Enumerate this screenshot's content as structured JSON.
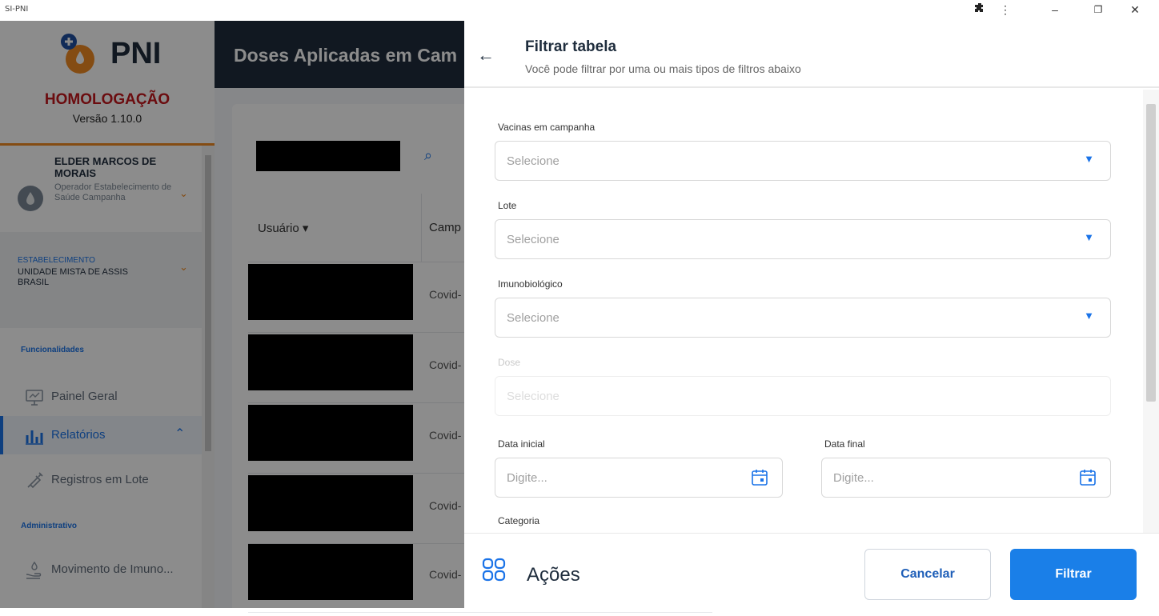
{
  "window": {
    "title": "SI-PNI"
  },
  "sidebar": {
    "brand": "PNI",
    "environment": "HOMOLOGAÇÃO",
    "version": "Versão 1.10.0",
    "user": {
      "name": "ELDER MARCOS DE MORAIS",
      "role": "Operador Estabelecimento de Saúde Campanha"
    },
    "establishment": {
      "label": "ESTABELECIMENTO",
      "name": "UNIDADE MISTA DE ASSIS BRASIL"
    },
    "section_functionalities": "Funcionalidades",
    "items": [
      {
        "label": "Painel Geral"
      },
      {
        "label": "Relatórios"
      },
      {
        "label": "Registros em Lote"
      }
    ],
    "section_admin": "Administrativo",
    "admin_items": [
      {
        "label": "Movimento de Imuno..."
      }
    ]
  },
  "main": {
    "title": "Doses Aplicadas em Cam",
    "table": {
      "col_user": "Usuário",
      "col_campaign": "Camp",
      "rows": [
        {
          "campaign": "Covid-"
        },
        {
          "campaign": "Covid-"
        },
        {
          "campaign": "Covid-"
        },
        {
          "campaign": "Covid-"
        },
        {
          "campaign": "Covid-"
        }
      ]
    }
  },
  "drawer": {
    "title": "Filtrar tabela",
    "subtitle": "Você pode filtrar por uma ou mais tipos de filtros abaixo",
    "fields": {
      "vacinas_label": "Vacinas em campanha",
      "vacinas_placeholder": "Selecione",
      "lote_label": "Lote",
      "lote_placeholder": "Selecione",
      "imuno_label": "Imunobiológico",
      "imuno_placeholder": "Selecione",
      "dose_label": "Dose",
      "dose_placeholder": "Selecione",
      "data_inicial_label": "Data inicial",
      "data_inicial_placeholder": "Digite...",
      "data_final_label": "Data final",
      "data_final_placeholder": "Digite...",
      "categoria_label": "Categoria"
    },
    "footer": {
      "actions_label": "Ações",
      "cancel_label": "Cancelar",
      "filter_label": "Filtrar"
    }
  },
  "colors": {
    "accent": "#1a7fe8",
    "brand_dark": "#1f2d3d",
    "env_red": "#c4161c",
    "orange": "#f08a24"
  }
}
